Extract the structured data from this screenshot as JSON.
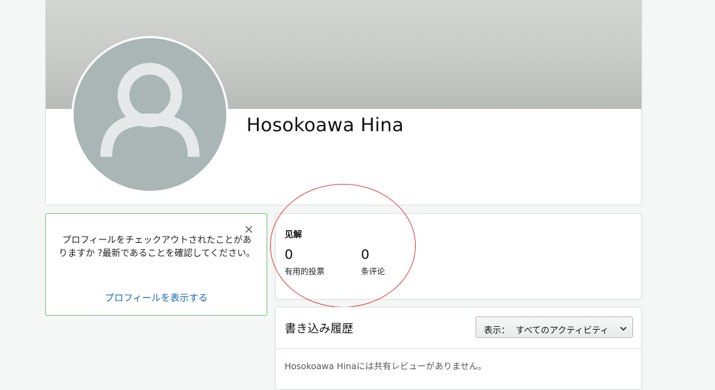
{
  "profile": {
    "name": "Hosokoawa Hina",
    "avatar_icon": "user-silhouette-icon"
  },
  "notice": {
    "message": "プロフィールをチェックアウトされたことがありますか ?最新であることを確認してください。",
    "link_label": "プロフィールを表示する",
    "close_icon": "close-icon"
  },
  "insights": {
    "title": "见解",
    "stats": [
      {
        "value": "0",
        "label": "有用的投票"
      },
      {
        "value": "0",
        "label": "条评论"
      }
    ]
  },
  "history": {
    "title": "書き込み履歴",
    "filter_prefix": "表示：",
    "filter_value": "すべてのアクティビティ",
    "empty_message": "Hosokoawa Hinaには共有レビューがありません。"
  },
  "colors": {
    "notice_border": "#7ac57f",
    "link": "#1a6ab5",
    "highlight": "#e04040",
    "avatar_bg": "#aab6b6"
  }
}
